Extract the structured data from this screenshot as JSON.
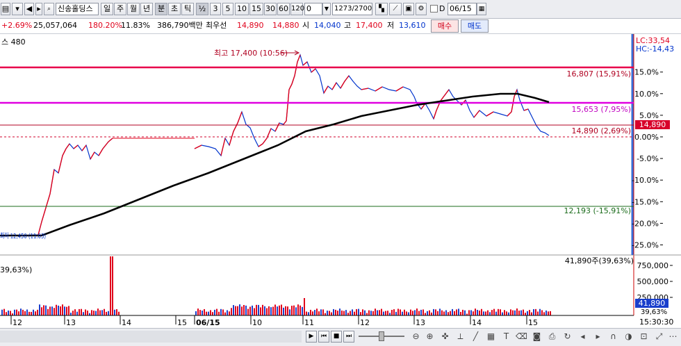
{
  "toolbar": {
    "stock_name": "신송홀딩스",
    "periods": [
      "일",
      "주",
      "월",
      "년",
      "분",
      "초",
      "틱"
    ],
    "fraction": "½",
    "intervals": [
      "3",
      "5",
      "10",
      "15",
      "30",
      "60",
      "120"
    ],
    "offset_value": "0",
    "count_value": "1273",
    "count_total": "/2700",
    "check_label": "D",
    "date_value": "06/15"
  },
  "quote": {
    "change_rate": "+2.69%",
    "volume": "25,057,064",
    "volume_ratio": "180.20%",
    "turnover": "11.83%",
    "amount": "386,790백만",
    "best_ask_label": "최우선",
    "best_ask": "14,890",
    "best_bid": "14,880",
    "open_label": "시",
    "open": "14,040",
    "high_label": "고",
    "high": "17,400",
    "low_label": "저",
    "low": "13,610",
    "buy_label": "매수",
    "sell_label": "매도"
  },
  "chart": {
    "indicator_label": "스 480",
    "lc": "LC:33,54",
    "hc": "HC:-14,43",
    "high_annotation": "최고 17,400 (10:56)",
    "low_annotation": "최저 12,450 (11:03)",
    "levels": [
      {
        "label": "16,807 (15,91%)",
        "color": "#e8004a"
      },
      {
        "label": "15,653 (7,95%)",
        "color": "#e000e0"
      },
      {
        "label": "14,890 (2,69%)",
        "color": "#b00020"
      },
      {
        "label": "12,193 (-15,91%)",
        "color": "#1a6b1a"
      }
    ],
    "y_ticks": [
      "15.0%",
      "10.0%",
      "5.0%",
      "0.00%",
      "-5.0%",
      "-10.0%",
      "-15.0%",
      "-20.0%",
      "-25.0%"
    ],
    "current_price": "14,890",
    "volume_label": "41,890주(39,63%)",
    "volume_left_label": "39,63%)",
    "vol_ticks": [
      "750,000",
      "500,000",
      "250,000"
    ],
    "vol_current": "41,890",
    "vol_pct": "39,63%",
    "x_labels": [
      "12",
      "13",
      "14",
      "15",
      "06/15",
      "10",
      "11",
      "12",
      "13",
      "14",
      "15"
    ],
    "time_label": "15:30:30"
  }
}
